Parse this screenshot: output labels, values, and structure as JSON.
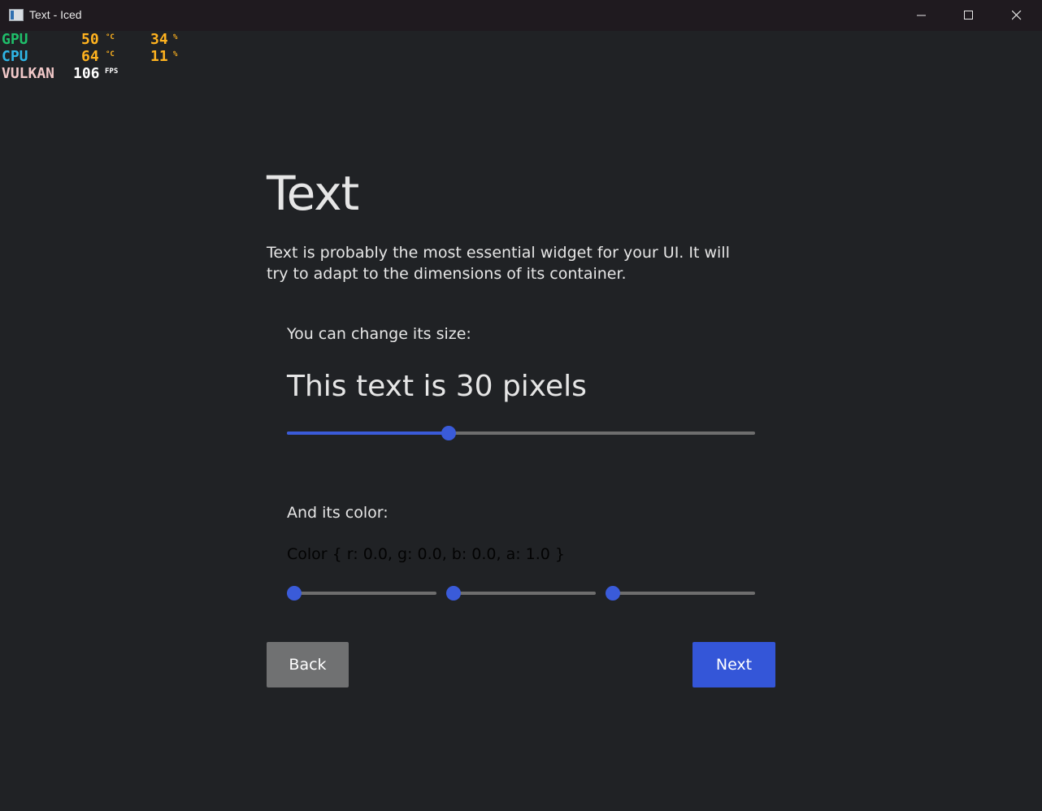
{
  "window": {
    "title": "Text - Iced"
  },
  "overlay": {
    "gpu": {
      "label": "GPU",
      "temp": "50",
      "temp_unit": "°C",
      "load": "34",
      "load_unit": "%"
    },
    "cpu": {
      "label": "CPU",
      "temp": "64",
      "temp_unit": "°C",
      "load": "11",
      "load_unit": "%"
    },
    "api": {
      "label": "VULKAN",
      "fps": "106",
      "fps_unit": "FPS"
    },
    "colors": {
      "gpu": "#1fbf6a",
      "cpu": "#2fb6e6",
      "vulkan": "#f2c9c9",
      "value": "#ffb31f"
    }
  },
  "page": {
    "title": "Text",
    "description": "Text is probably the most essential widget for your UI. It will try to adapt to the dimensions of its container.",
    "size_label": "You can change its size:",
    "size_demo": "This text is 30 pixels",
    "size_slider_value": 0.34,
    "color_label": "And its color:",
    "color_value": "Color { r: 0.0, g: 0.0, b: 0.0, a: 1.0 }",
    "color_sliders": {
      "r": 0.0,
      "g": 0.0,
      "b": 0.0
    }
  },
  "buttons": {
    "back": "Back",
    "next": "Next"
  },
  "theme": {
    "accent": "#3a5bd9",
    "background": "#202225",
    "text": "#e6e6e6"
  }
}
